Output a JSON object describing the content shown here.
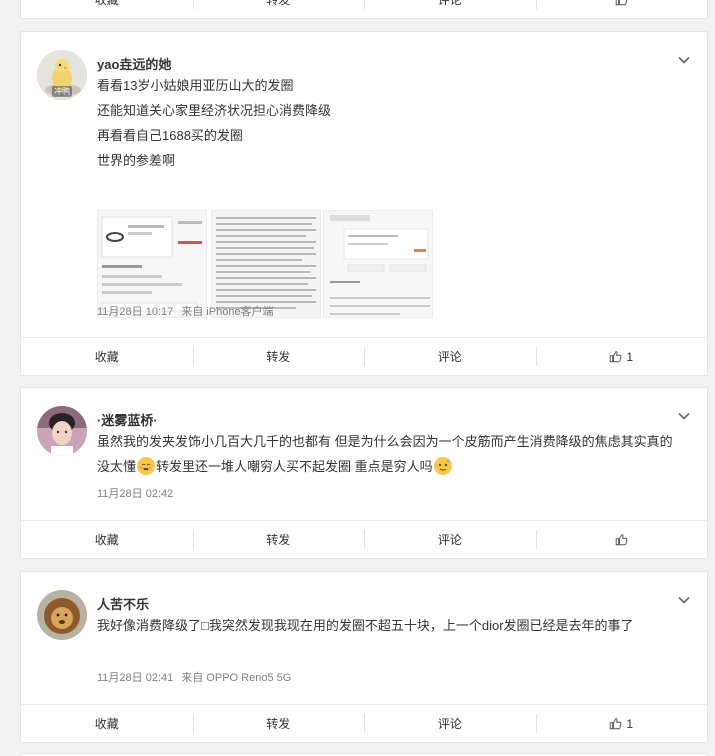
{
  "top_bar": {
    "collect": "收藏",
    "repost": "转发",
    "comment": "评论"
  },
  "posts": [
    {
      "username": "yao垚远的她",
      "avatar_badge": "冲鸭",
      "lines": [
        "看看13岁小姑娘用亚历山大的发圈",
        "还能知道关心家里经济状况担心消费降级",
        "再看看自己1688买的发圈",
        "世界的参差啊"
      ],
      "time": "11月28日 10:17",
      "source": "来自 iPhone客户端",
      "actions": {
        "collect": "收藏",
        "repost": "转发",
        "comment": "评论",
        "like_count": "1"
      }
    },
    {
      "username": "·迷雾蓝桥·",
      "text_part1": "虽然我的发夹发饰小几百大几千的也都有 但是为什么会因为一个皮筋而产生消费降级的焦虑其实真的没太懂",
      "text_part2": "转发里还一堆人嘲穷人买不起发圈 重点是穷人吗",
      "time": "11月28日 02:42",
      "actions": {
        "collect": "收藏",
        "repost": "转发",
        "comment": "评论"
      }
    },
    {
      "username": "人苦不乐",
      "text": "我好像消费降级了□我突然发现我现在用的发圈不超五十块，上一个dior发圈已经是去年的事了",
      "time": "11月28日 02:41",
      "source": "来自 OPPO Reno5 5G",
      "actions": {
        "collect": "收藏",
        "repost": "转发",
        "comment": "评论",
        "like_count": "1"
      }
    }
  ],
  "colors": {
    "background": "#f2f2f2",
    "card": "#ffffff",
    "text": "#333333",
    "meta": "#808080"
  },
  "icons": [
    "chevron-down-icon",
    "thumbs-up-icon",
    "avatar-image"
  ]
}
